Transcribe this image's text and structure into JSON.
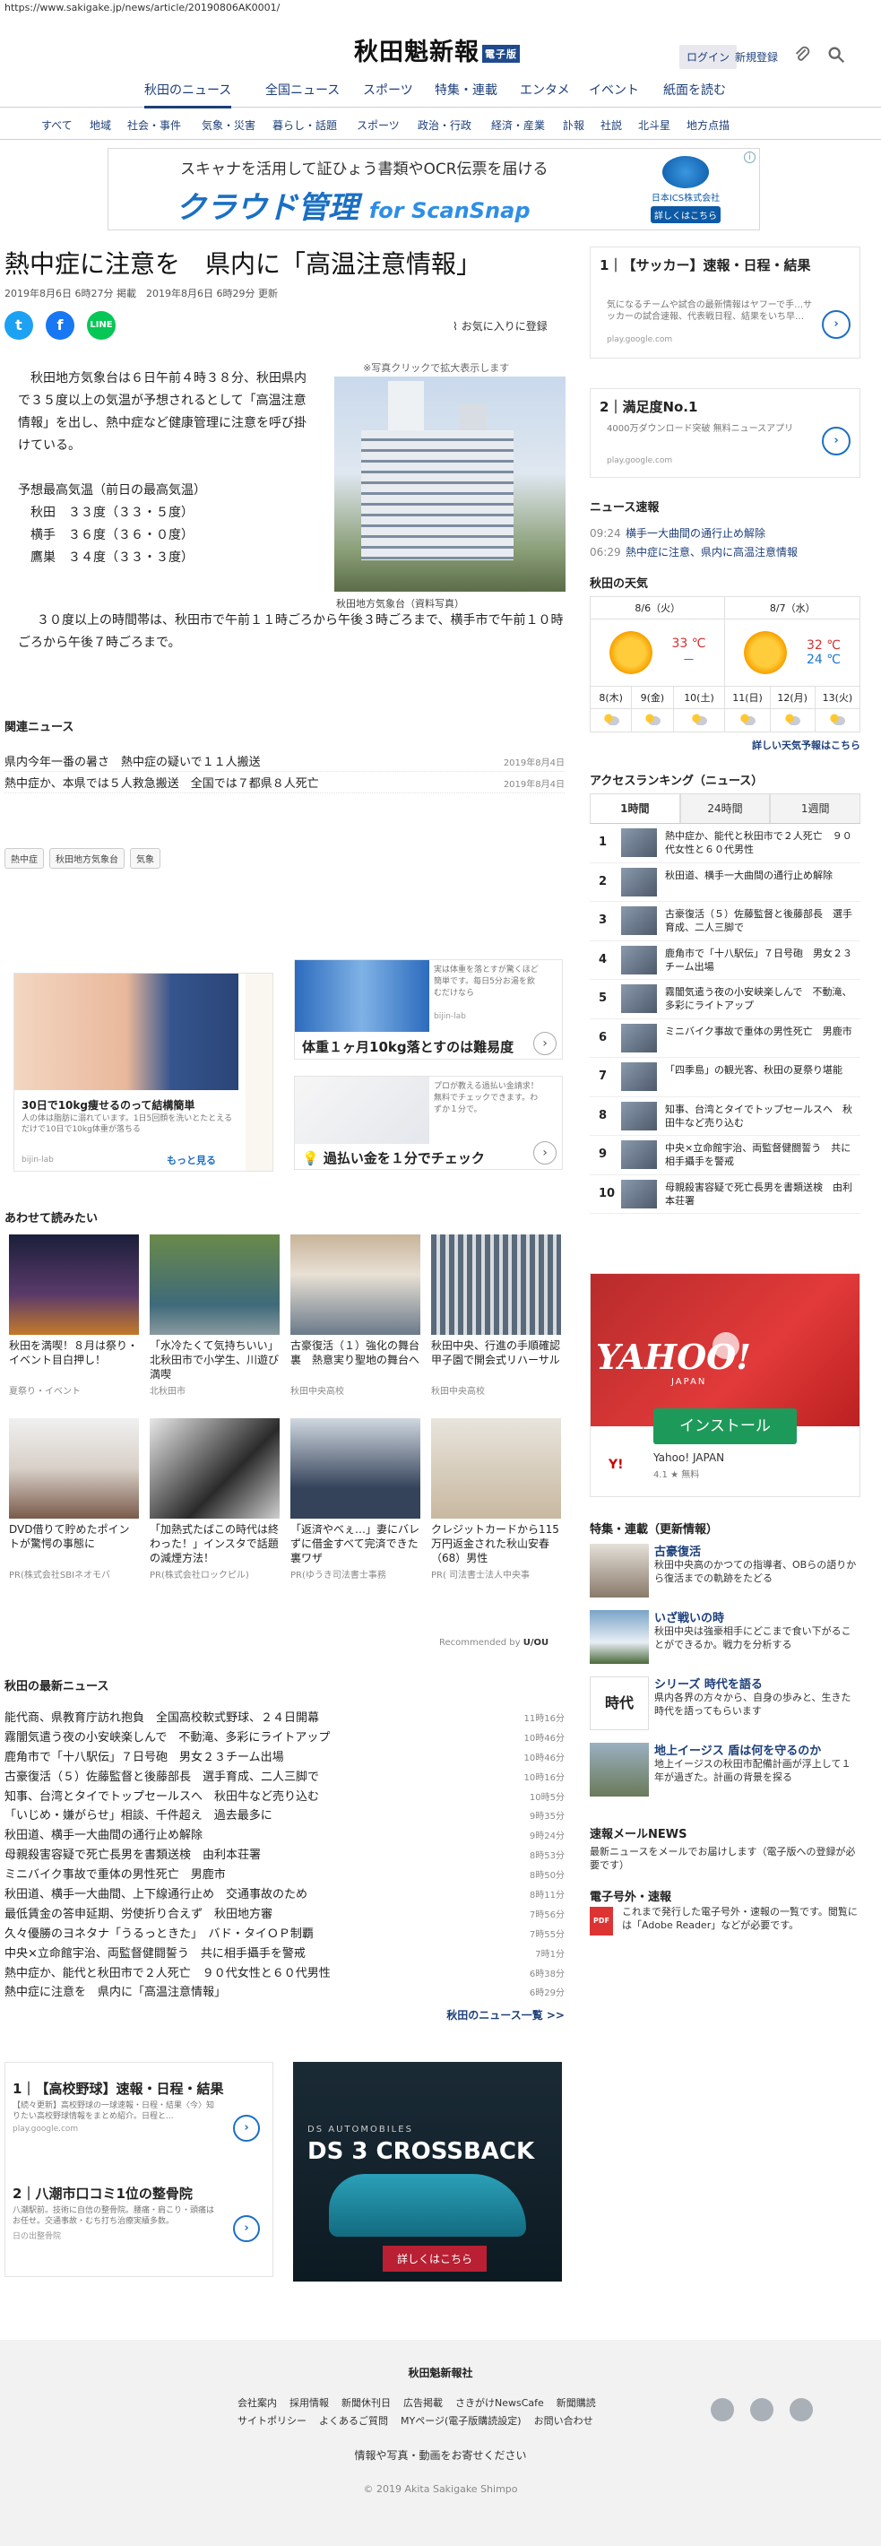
{
  "url": "https://www.sakigake.jp/news/article/20190806AK0001/",
  "header": {
    "logo": "秋田魁新報",
    "logo_badge": "電子版",
    "login": "ログイン",
    "signup": "新規登録",
    "main_nav": [
      "秋田のニュース",
      "全国ニュース",
      "スポーツ",
      "特集・連載",
      "エンタメ",
      "イベント",
      "紙面を読む"
    ],
    "sub_nav": [
      "すべて",
      "地域",
      "社会・事件",
      "気象・災害",
      "暮らし・話題",
      "スポーツ",
      "政治・行政",
      "経済・産業",
      "訃報",
      "社説",
      "北斗星",
      "地方点描"
    ]
  },
  "banner": {
    "line1": "スキャナを活用して証ひょう書類やOCR伝票を届ける",
    "line2": "クラウド管理",
    "line2b": "for ScanSnap",
    "brand": "日本ICS株式会社",
    "cta": "詳しくはこちら"
  },
  "article": {
    "title": "熱中症に注意を　県内に「高温注意情報」",
    "published": "2019年8月6日 6時27分 掲載",
    "updated": "2019年8月6日 6時29分 更新",
    "favorite": "お気に入りに登録",
    "zoom_note": "※写真クリックで拡大表示します",
    "caption": "秋田地方気象台（資料写真）",
    "p1": "秋田地方気象台は６日午前４時３８分、秋田県内で３５度以上の気温が予想されるとして「高温注意情報」を出し、熱中症など健康管理に注意を呼び掛けている。",
    "p2_head": "予想最高気温（前日の最高気温）",
    "temps": [
      "秋田　３３度（３３・５度）",
      "横手　３６度（３６・０度）",
      "鷹巣　３４度（３３・３度）"
    ],
    "p3": "３０度以上の時間帯は、秋田市で午前１１時ごろから午後３時ごろまで、横手市で午前１０時ごろから午後７時ごろまで。"
  },
  "related": {
    "heading": "関連ニュース",
    "items": [
      {
        "text": "県内今年一番の暑さ　熱中症の疑いで１１人搬送",
        "date": "2019年8月4日"
      },
      {
        "text": "熱中症か、本県では５人救急搬送　全国では７都県８人死亡",
        "date": "2019年8月4日"
      }
    ]
  },
  "tags": [
    "熱中症",
    "秋田地方気象台",
    "気象"
  ],
  "ads": {
    "left": {
      "title": "30日で10kg痩せるのって結構簡単",
      "desc": "人の体は脂肪に溺れています。1日5回顔を洗いとたとえるだけで10日で10kg体重が落ちる",
      "src": "bijin-lab",
      "more": "もっと見る"
    },
    "right1": {
      "title": "体重１ヶ月10kg落とすのは難易度",
      "desc": "実は体重を落とすが驚くほど簡単です。毎日5分お湯を飲むだけなら",
      "src": "bijin-lab"
    },
    "right2": {
      "title": "過払い金を１分でチェック",
      "desc": "プロが教える過払い金請求！無料でチェックできます。わずか１分で。"
    }
  },
  "recs": {
    "heading": "あわせて読みたい",
    "items": [
      {
        "title": "秋田を満喫！８月は祭り・イベント目白押し！",
        "src": "夏祭り・イベント"
      },
      {
        "title": "「水冷たくて気持ちいい」　北秋田市で小学生、川遊び満喫",
        "src": "北秋田市"
      },
      {
        "title": "古豪復活（１）強化の舞台裏　熱意実り聖地の舞台へ",
        "src": "秋田中央高校"
      },
      {
        "title": "秋田中央、行進の手順確認　甲子園で開会式リハーサル",
        "src": "秋田中央高校"
      },
      {
        "title": "DVD借りて貯めたポイントが驚愕の事態に",
        "src": "PR(株式会社SBIネオモバ"
      },
      {
        "title": "「加熱式たばこの時代は終わった！」インスタで話題の減煙方法！",
        "src": "PR(株式会社ロックピル)"
      },
      {
        "title": "「返済やべぇ…」妻にバレずに借金すべて完済できた裏ワザ",
        "src": "PR(ゆうき司法書士事務"
      },
      {
        "title": "クレジットカードから115万円返金された秋山安春（68）男性",
        "src": "PR( 司法書士法人中央事"
      }
    ],
    "by": "Recommended by",
    "by_brand": "U/OU"
  },
  "latest": {
    "heading": "秋田の最新ニュース",
    "items": [
      {
        "text": "能代商、県教育庁訪れ抱負　全国高校軟式野球、２４日開幕",
        "time": "11時16分"
      },
      {
        "text": "霧闇気遣う夜の小安峡楽しんで　不動滝、多彩にライトアップ",
        "time": "10時46分"
      },
      {
        "text": "鹿角市で「十八駅伝」７日号砲　男女２３チーム出場",
        "time": "10時46分"
      },
      {
        "text": "古豪復活（５）佐藤監督と後藤部長　選手育成、二人三脚で",
        "time": "10時16分"
      },
      {
        "text": "知事、台湾とタイでトップセールスへ　秋田牛など売り込む",
        "time": "10時5分"
      },
      {
        "text": "「いじめ・嫌がらせ」相談、千件超え　過去最多に",
        "time": "9時35分"
      },
      {
        "text": "秋田道、横手一大曲間の通行止め解除",
        "time": "9時24分"
      },
      {
        "text": "母親殺害容疑で死亡長男を書類送検　由利本荘署",
        "time": "8時53分"
      },
      {
        "text": "ミニバイク事故で重体の男性死亡　男鹿市",
        "time": "8時50分"
      },
      {
        "text": "秋田道、横手一大曲間、上下線通行止め　交通事故のため",
        "time": "8時11分"
      },
      {
        "text": "最低賃金の答申延期、労使折り合えず　秋田地方審",
        "time": "7時56分"
      },
      {
        "text": "久々優勝のヨネタナ「うるっときた」　バド・タイＯＰ制覇",
        "time": "7時55分"
      },
      {
        "text": "中央×立命館宇治、両監督健闘誓う　共に相手攝手を警戒",
        "time": "7時1分"
      },
      {
        "text": "熱中症か、能代と秋田市で２人死亡　９０代女性と６０代男性",
        "time": "6時38分"
      },
      {
        "text": "熱中症に注意を　県内に「高温注意情報」",
        "time": "6時29分"
      }
    ],
    "more": "秋田のニュース一覧 >>"
  },
  "bottom_left": [
    {
      "num": "1",
      "title": "【高校野球】速報・日程・結果",
      "desc": "【続々更新】高校野球の一球速報・日程・結果〈今〉知りたい高校野球情報をまとめ紹介。日程と...",
      "src": "play.google.com"
    },
    {
      "num": "2",
      "title": "八潮市口コミ1位の整骨院",
      "desc": "八潮駅前。技術に自信の整骨院。腰痛・肩こり・頭痛はお任せ。交通事故・むち打ち治療実績多数。",
      "src": "日の出整骨院"
    }
  ],
  "bottom_ad": {
    "brand": "DS AUTOMOBILES",
    "name": "DS 3 CROSSBACK",
    "cta": "詳しくはこちら"
  },
  "sidebar": {
    "ad1": {
      "num": "1",
      "title": "【サッカー】速報・日程・結果",
      "desc": "気になるチームや試合の最新情報はヤフーで手…サッカーの試合速報、代表戦日程、結果をいち早…",
      "src": "play.google.com"
    },
    "ad2": {
      "num": "2",
      "title": "満足度No.1",
      "desc": "4000万ダウンロード突破 無料ニュースアプリ",
      "src": "play.google.com"
    },
    "flash": {
      "heading": "ニュース速報",
      "items": [
        {
          "time": "09:24",
          "text": "横手一大曲間の通行止め解除"
        },
        {
          "time": "06:29",
          "text": "熱中症に注意、県内に高温注意情報"
        }
      ]
    },
    "weather": {
      "heading": "秋田の天気",
      "days": [
        {
          "date": "8/6（火）",
          "high": "33 ℃",
          "low": "－"
        },
        {
          "date": "8/7（水）",
          "high": "32 ℃",
          "low": "24 ℃"
        }
      ],
      "week": [
        "8(木)",
        "9(金)",
        "10(土)",
        "11(日)",
        "12(月)",
        "13(火)"
      ],
      "detail": "詳しい天気予報はこちら"
    },
    "ranking": {
      "heading": "アクセスランキング（ニュース）",
      "tabs": [
        "1時間",
        "24時間",
        "1週間"
      ],
      "items": [
        {
          "n": "1",
          "text": "熱中症か、能代と秋田市で２人死亡　９０代女性と６０代男性"
        },
        {
          "n": "2",
          "text": "秋田道、横手一大曲間の通行止め解除"
        },
        {
          "n": "3",
          "text": "古豪復活（５）佐藤監督と後藤部長　選手育成、二人三脚で"
        },
        {
          "n": "4",
          "text": "鹿角市で「十八駅伝」７日号砲　男女２３チーム出場"
        },
        {
          "n": "5",
          "text": "霧闇気遣う夜の小安峡楽しんで　不動滝、多彩にライトアップ"
        },
        {
          "n": "6",
          "text": "ミニバイク事故で重体の男性死亡　男鹿市"
        },
        {
          "n": "7",
          "text": "「四季島」の観光客、秋田の夏祭り堪能"
        },
        {
          "n": "8",
          "text": "知事、台湾とタイでトップセールスへ　秋田牛など売り込む"
        },
        {
          "n": "9",
          "text": "中央×立命館宇治、両監督健闘誓う　共に相手攝手を警戒"
        },
        {
          "n": "10",
          "text": "母親殺害容疑で死亡長男を書類送検　由利本荘署"
        }
      ]
    },
    "yahoo": {
      "logo": "YAHOO!",
      "jp": "JAPAN",
      "install": "インストール",
      "name": "Yahoo! JAPAN",
      "rating": "4.1 ★ 無料"
    },
    "features": {
      "heading": "特集・連載（更新情報）",
      "items": [
        {
          "title": "古豪復活",
          "desc": "秋田中央高のかつての指導者、OBらの語りから復活までの軌跡をたどる"
        },
        {
          "title": "いざ戦いの時",
          "desc": "秋田中央は強豪相手にどこまで食い下がることができるか。戦力を分析する"
        },
        {
          "title": "シリーズ 時代を語る",
          "desc": "県内各界の方々から、自身の歩みと、生きた時代を語ってもらいます"
        },
        {
          "title": "地上イージス 盾は何を守るのか",
          "desc": "地上イージスの秋田市配備計画が浮上して１年が過ぎた。計画の背景を探る"
        }
      ]
    },
    "mail": {
      "heading": "速報メールNEWS",
      "desc": "最新ニュースをメールでお届けします（電子版への登録が必要です）"
    },
    "extra": {
      "heading": "電子号外・速報",
      "desc": "これまで発行した電子号外・速報の一覧です。閲覧には「Adobe Reader」などが必要です。",
      "pdf": "PDF"
    }
  },
  "footer": {
    "company": "秋田魁新報社",
    "links1": [
      "会社案内",
      "採用情報",
      "新聞休刊日",
      "広告掲載",
      "さきがけNewsCafe",
      "新聞購読"
    ],
    "links2": [
      "サイトポリシー",
      "よくあるご質問",
      "MYページ(電子版購読設定)",
      "お問い合わせ"
    ],
    "ask": "情報や写真・動画をお寄せください",
    "copyright": "© 2019 Akita Sakigake Shimpo"
  }
}
